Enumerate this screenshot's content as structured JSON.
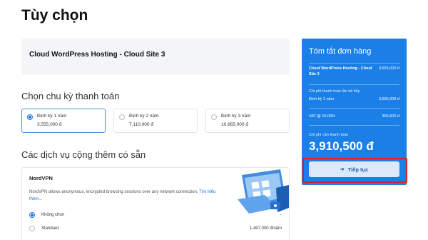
{
  "page": {
    "title": "Tùy chọn"
  },
  "product": {
    "name": "Cloud WordPress Hosting - Cloud Site 3"
  },
  "billing": {
    "title": "Chọn chu kỳ thanh toán",
    "plans": [
      {
        "label": "Định kỳ 1 năm",
        "price": "3,555,000 đ",
        "selected": true
      },
      {
        "label": "Định kỳ 2 năm",
        "price": "7,110,000 đ",
        "selected": false
      },
      {
        "label": "Định kỳ 3 năm",
        "price": "10,665,000 đ",
        "selected": false
      }
    ]
  },
  "addons": {
    "title": "Các dịch vụ cộng thêm có sẵn",
    "items": [
      {
        "name": "NordVPN",
        "description": "NordVPN allows anonymous, encrypted browsing sessions over any network connection.",
        "link_text": "Tìm hiểu thêm...",
        "options": [
          {
            "label": "Không chọn",
            "price": "-",
            "selected": true
          },
          {
            "label": "Standard",
            "price": "1,497,000 đ/năm",
            "selected": false
          }
        ]
      }
    ]
  },
  "summary": {
    "title": "Tóm tắt đơn hàng",
    "product_line": {
      "label": "Cloud WordPress Hosting - Cloud Site 3",
      "value": "3,555,000 đ"
    },
    "recurring_heading": "Chi phí thanh toán lần kế tiếp",
    "recurring_line": {
      "label": "Định kỳ 1 năm",
      "value": "3,555,000 đ"
    },
    "vat_line": {
      "label": "VAT @ 10.00%",
      "value": "355,500 đ"
    },
    "due_label": "Chi phí cần thanh toán",
    "total": "3,910,500 đ",
    "continue_label": "Tiếp tục"
  },
  "colors": {
    "accent": "#1a7fe6",
    "highlight": "#d8202a",
    "button_bg": "#dbe9fa"
  },
  "icons": {
    "continue": "arrow-right-icon"
  }
}
